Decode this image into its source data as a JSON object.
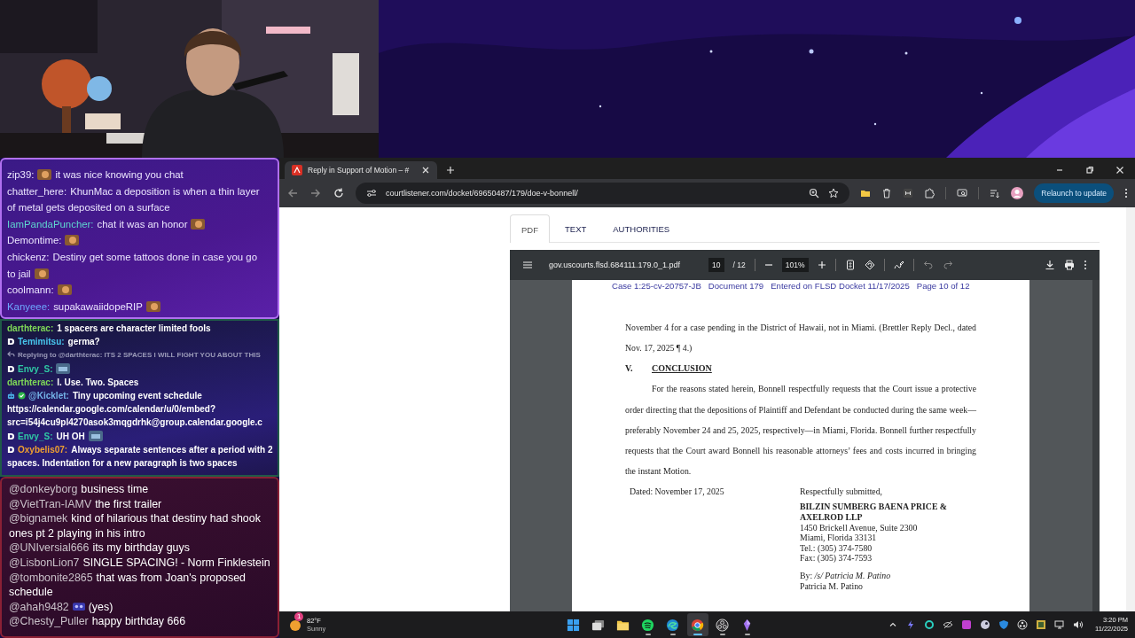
{
  "chat_top": [
    {
      "user": "zip39:",
      "color": "#ece6ff",
      "parts": [
        {
          "kind": "emote"
        },
        {
          "kind": "text",
          "text": "it was nice knowing you chat"
        }
      ]
    },
    {
      "user": "chatter_here:",
      "color": "#ece6ff",
      "parts": [
        {
          "kind": "text",
          "text": "KhunMac a deposition is when a thin layer"
        },
        {
          "kind": "text",
          "text": "of metal gets deposited on a surface"
        }
      ]
    },
    {
      "user": "IamPandaPuncher:",
      "color": "#5fd6d0",
      "parts": [
        {
          "kind": "text",
          "text": "chat it was an honor"
        },
        {
          "kind": "emote"
        }
      ]
    },
    {
      "user": "Demontime:",
      "color": "#ece6ff",
      "parts": [
        {
          "kind": "emote"
        }
      ]
    },
    {
      "user": "chickenz:",
      "color": "#ece6ff",
      "parts": [
        {
          "kind": "text",
          "text": "Destiny get some tattoos done in case you go"
        },
        {
          "kind": "text",
          "text": "to jail"
        },
        {
          "kind": "emote"
        }
      ]
    },
    {
      "user": "coolmann:",
      "color": "#ece6ff",
      "parts": [
        {
          "kind": "emote"
        }
      ]
    },
    {
      "user": "Kanyeee:",
      "color": "#6ea8ff",
      "parts": [
        {
          "kind": "text",
          "text": "supakawaiidopeRIP"
        },
        {
          "kind": "emote"
        }
      ]
    }
  ],
  "chat_middle": [
    {
      "kind": "message",
      "badge": false,
      "bot": false,
      "verified": false,
      "user": "darthterac:",
      "color": "#7fd957",
      "parts": [
        {
          "kind": "text",
          "text": "1 spacers are character limited fools"
        }
      ]
    },
    {
      "kind": "message",
      "badge": true,
      "bot": false,
      "verified": false,
      "user": "Temimitsu:",
      "color": "#48c6ee",
      "parts": [
        {
          "kind": "text",
          "text": "germa?"
        }
      ]
    },
    {
      "kind": "reply",
      "text": "Replying to @darthterac: ITS 2 SPACES I WILL FIGHT YOU ABOUT THIS"
    },
    {
      "kind": "message",
      "badge": true,
      "bot": false,
      "verified": false,
      "user": "Envy_S:",
      "color": "#2fc8a4",
      "parts": [
        {
          "kind": "emote"
        }
      ]
    },
    {
      "kind": "message",
      "badge": false,
      "bot": false,
      "verified": false,
      "user": "darthterac:",
      "color": "#7fd957",
      "parts": [
        {
          "kind": "text",
          "text": "I. Use. Two. Spaces"
        }
      ]
    },
    {
      "kind": "message",
      "badge": false,
      "bot": true,
      "verified": true,
      "user": "@Kicklet:",
      "color": "#74b4e8",
      "parts": [
        {
          "kind": "text",
          "text": "Tiny upcoming event schedule"
        },
        {
          "kind": "text",
          "text": "https://calendar.google.com/calendar/u/0/embed?"
        },
        {
          "kind": "text",
          "text": "src=i54j4cu9pl4270asok3mqgdrhk@group.calendar.google.c"
        }
      ]
    },
    {
      "kind": "message",
      "badge": true,
      "bot": false,
      "verified": false,
      "user": "Envy_S:",
      "color": "#2fc8a4",
      "parts": [
        {
          "kind": "text",
          "text": "UH OH"
        },
        {
          "kind": "emote"
        }
      ]
    },
    {
      "kind": "message",
      "badge": true,
      "bot": false,
      "verified": false,
      "user": "Oxybelis07:",
      "color": "#f0a030",
      "parts": [
        {
          "kind": "text",
          "text": "Always separate sentences after a period with 2"
        },
        {
          "kind": "text",
          "text": "spaces. Indentation for a new paragraph is two spaces"
        }
      ]
    }
  ],
  "chat_bottom": [
    {
      "user": "@donkeyborg",
      "parts": [
        {
          "kind": "text",
          "text": "business time"
        }
      ]
    },
    {
      "user": "@VietTran-IAMV",
      "parts": [
        {
          "kind": "text",
          "text": "the first trailer"
        }
      ]
    },
    {
      "user": "@bignamek",
      "parts": [
        {
          "kind": "text",
          "text": "kind of hilarious that destiny had shook"
        },
        {
          "kind": "text",
          "text": "ones pt 2 playing in his intro"
        }
      ]
    },
    {
      "user": "@UNIversial666",
      "parts": [
        {
          "kind": "text",
          "text": "its my birthday guys"
        }
      ]
    },
    {
      "user": "@LisbonLion7",
      "parts": [
        {
          "kind": "text",
          "text": "SINGLE SPACING! - Norm Finklestein"
        }
      ]
    },
    {
      "user": "@tombonite2865",
      "parts": [
        {
          "kind": "text",
          "text": "that was from Joan's proposed"
        },
        {
          "kind": "text",
          "text": "schedule"
        }
      ]
    },
    {
      "user": "@ahah9482",
      "parts": [
        {
          "kind": "emote"
        },
        {
          "kind": "text",
          "text": "(yes)"
        }
      ]
    },
    {
      "user": "@Chesty_Puller",
      "parts": [
        {
          "kind": "text",
          "text": "happy birthday 666"
        }
      ]
    }
  ],
  "browser": {
    "tab_title": "Reply in Support of Motion – #",
    "url": "courtlistener.com/docket/69650487/179/doe-v-bonnell/",
    "relaunch_button": "Relaunch to update",
    "doc_tabs": [
      {
        "label": "PDF",
        "selected": true
      },
      {
        "label": "TEXT",
        "selected": false
      },
      {
        "label": "AUTHORITIES",
        "selected": false
      }
    ],
    "pdf_viewer": {
      "filename": "gov.uscourts.flsd.684111.179.0_1.pdf",
      "page": "10",
      "page_total": "/ 12",
      "zoom": "101%",
      "page_header": "Case 1:25-cv-20757-JB   Document 179   Entered on FLSD Docket 11/17/2025   Page 10 of 12",
      "paragraphs": [
        {
          "indent": false,
          "text": "November 4 for a case pending in the District of Hawaii, not in Miami. (Brettler Reply Decl., dated Nov. 17, 2025 ¶ 4.)"
        }
      ],
      "heading_number": "V.",
      "heading": "CONCLUSION",
      "conclusion": [
        {
          "indent": true,
          "text": "For the reasons stated herein, Bonnell respectfully requests that the Court issue a protective order directing that the depositions of Plaintiff and Defendant be conducted during the same week—preferably November 24 and 25, 2025, respectively—in Miami, Florida. Bonnell further respectfully requests that the Court award Bonnell his reasonable attorneys’ fees and costs incurred in bringing the instant Motion."
        }
      ],
      "dated": "Dated: November 17, 2025",
      "signature": {
        "closing": "Respectfully submitted,",
        "firm": "BILZIN SUMBERG BAENA PRICE & AXELROD LLP",
        "address_lines": [
          "1450 Brickell Avenue, Suite 2300",
          "Miami, Florida 33131",
          "Tel.: (305) 374-7580",
          "Fax: (305) 374-7593"
        ],
        "by": "By: */s/ Patricia M. Patino*",
        "name": "Patricia M. Patino"
      }
    }
  },
  "taskbar": {
    "weather": {
      "badge": "1",
      "temperature": "82°F",
      "condition": "Sunny"
    },
    "apps": [
      {
        "kind": "windows",
        "running": false,
        "selected": false
      },
      {
        "kind": "taskview",
        "running": false,
        "selected": false
      },
      {
        "kind": "folder",
        "running": false,
        "selected": false
      },
      {
        "kind": "spotify",
        "running": true,
        "selected": false
      },
      {
        "kind": "edge",
        "running": true,
        "selected": false
      },
      {
        "kind": "chrome",
        "running": true,
        "selected": true
      },
      {
        "kind": "obs",
        "running": true,
        "selected": false
      },
      {
        "kind": "crystal",
        "running": true,
        "selected": false
      }
    ],
    "time": "3:20 PM",
    "date": "11/22/2025"
  }
}
